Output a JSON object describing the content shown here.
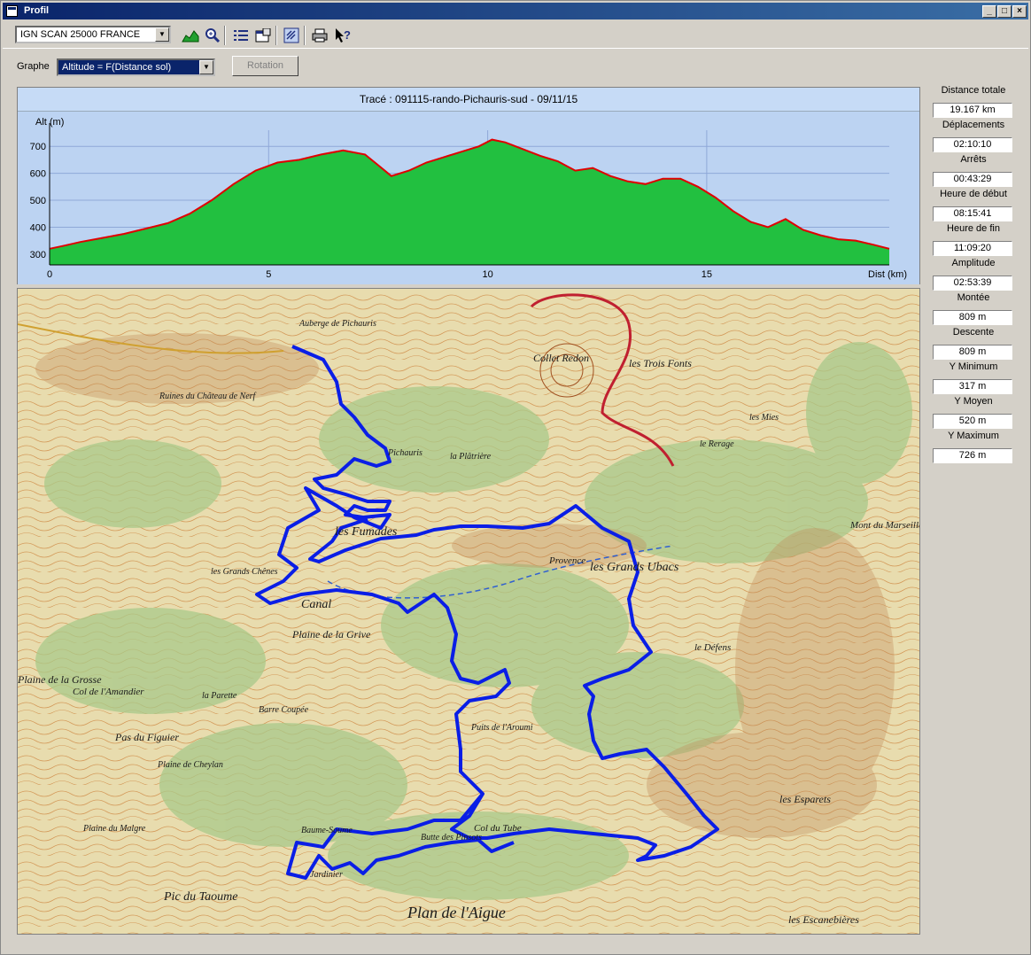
{
  "window": {
    "title": "Profil"
  },
  "toolbar": {
    "map_select": "IGN SCAN 25000 FRANCE",
    "buttons": [
      "profile-icon",
      "zoom-icon",
      "list-icon",
      "properties-icon",
      "export-icon",
      "print-icon",
      "help-icon"
    ]
  },
  "graph": {
    "label": "Graphe",
    "select_value": "Altitude = F(Distance sol)",
    "rotation_label": "Rotation"
  },
  "chart_data": {
    "type": "area",
    "title": "Tracé : 091115-rando-Pichauris-sud - 09/11/15",
    "xlabel": "Dist (km)",
    "ylabel": "Alt (m)",
    "xlim": [
      0,
      19.167
    ],
    "ylim": [
      260,
      760
    ],
    "xticks": [
      0,
      5,
      10,
      15
    ],
    "yticks": [
      300,
      400,
      500,
      600,
      700
    ],
    "grid": true,
    "fill_color": "#22c040",
    "line_color": "#e00000",
    "x": [
      0,
      0.3,
      0.7,
      1.2,
      1.7,
      2.2,
      2.7,
      3.2,
      3.7,
      4.2,
      4.7,
      5.2,
      5.7,
      6.2,
      6.7,
      7.2,
      7.5,
      7.8,
      8.2,
      8.6,
      9.0,
      9.4,
      9.8,
      10.1,
      10.4,
      10.8,
      11.2,
      11.6,
      12.0,
      12.4,
      12.8,
      13.2,
      13.6,
      14.0,
      14.4,
      14.8,
      15.2,
      15.6,
      16.0,
      16.4,
      16.8,
      17.2,
      17.6,
      18.0,
      18.4,
      18.8,
      19.167
    ],
    "y": [
      320,
      330,
      345,
      360,
      375,
      395,
      415,
      450,
      500,
      560,
      610,
      640,
      650,
      670,
      685,
      670,
      630,
      590,
      610,
      640,
      660,
      680,
      700,
      725,
      715,
      690,
      665,
      645,
      610,
      620,
      590,
      570,
      560,
      580,
      580,
      550,
      510,
      460,
      420,
      400,
      430,
      390,
      370,
      355,
      350,
      335,
      320
    ]
  },
  "stats": [
    {
      "name": "Distance totale",
      "value": "19.167 km"
    },
    {
      "name": "Déplacements",
      "value": "02:10:10"
    },
    {
      "name": "Arrêts",
      "value": "00:43:29"
    },
    {
      "name": "Heure de début",
      "value": "08:15:41"
    },
    {
      "name": "Heure de fin",
      "value": "11:09:20"
    },
    {
      "name": "Amplitude",
      "value": "02:53:39"
    },
    {
      "name": "Montée",
      "value": "809 m"
    },
    {
      "name": "Descente",
      "value": "809 m"
    },
    {
      "name": "Y Minimum",
      "value": "317 m"
    },
    {
      "name": "Y Moyen",
      "value": "520 m"
    },
    {
      "name": "Y Maximum",
      "value": "726 m"
    }
  ],
  "map": {
    "labels": [
      "Auberge de Pichauris",
      "Collet Redon",
      "les Trois Fonts",
      "Ruines du Château de Nerf",
      "Pichauris",
      "la Plâtrière",
      "les Fumades",
      "les Grands Chênes",
      "les Grands Ubacs",
      "Provence",
      "Plaine de la Grive",
      "Canal",
      "le Défens",
      "Col de l'Amandier",
      "la Parette",
      "Barre Coupée",
      "Pas du Figuier",
      "Plaine de Cheylan",
      "Puits de l'Aroumi",
      "Col du Tube",
      "Butte des Pinsots",
      "Baume-Soume",
      "Jardinier",
      "Pic du Taoume",
      "Plan de l'Aigue",
      "les Esparets",
      "Mont du Marseillais",
      "les Escanebières",
      "Plaine de la Grosse",
      "le Rerage",
      "les Mies",
      "Plaine du Malgre"
    ],
    "track_color": "#0a1ee6"
  }
}
